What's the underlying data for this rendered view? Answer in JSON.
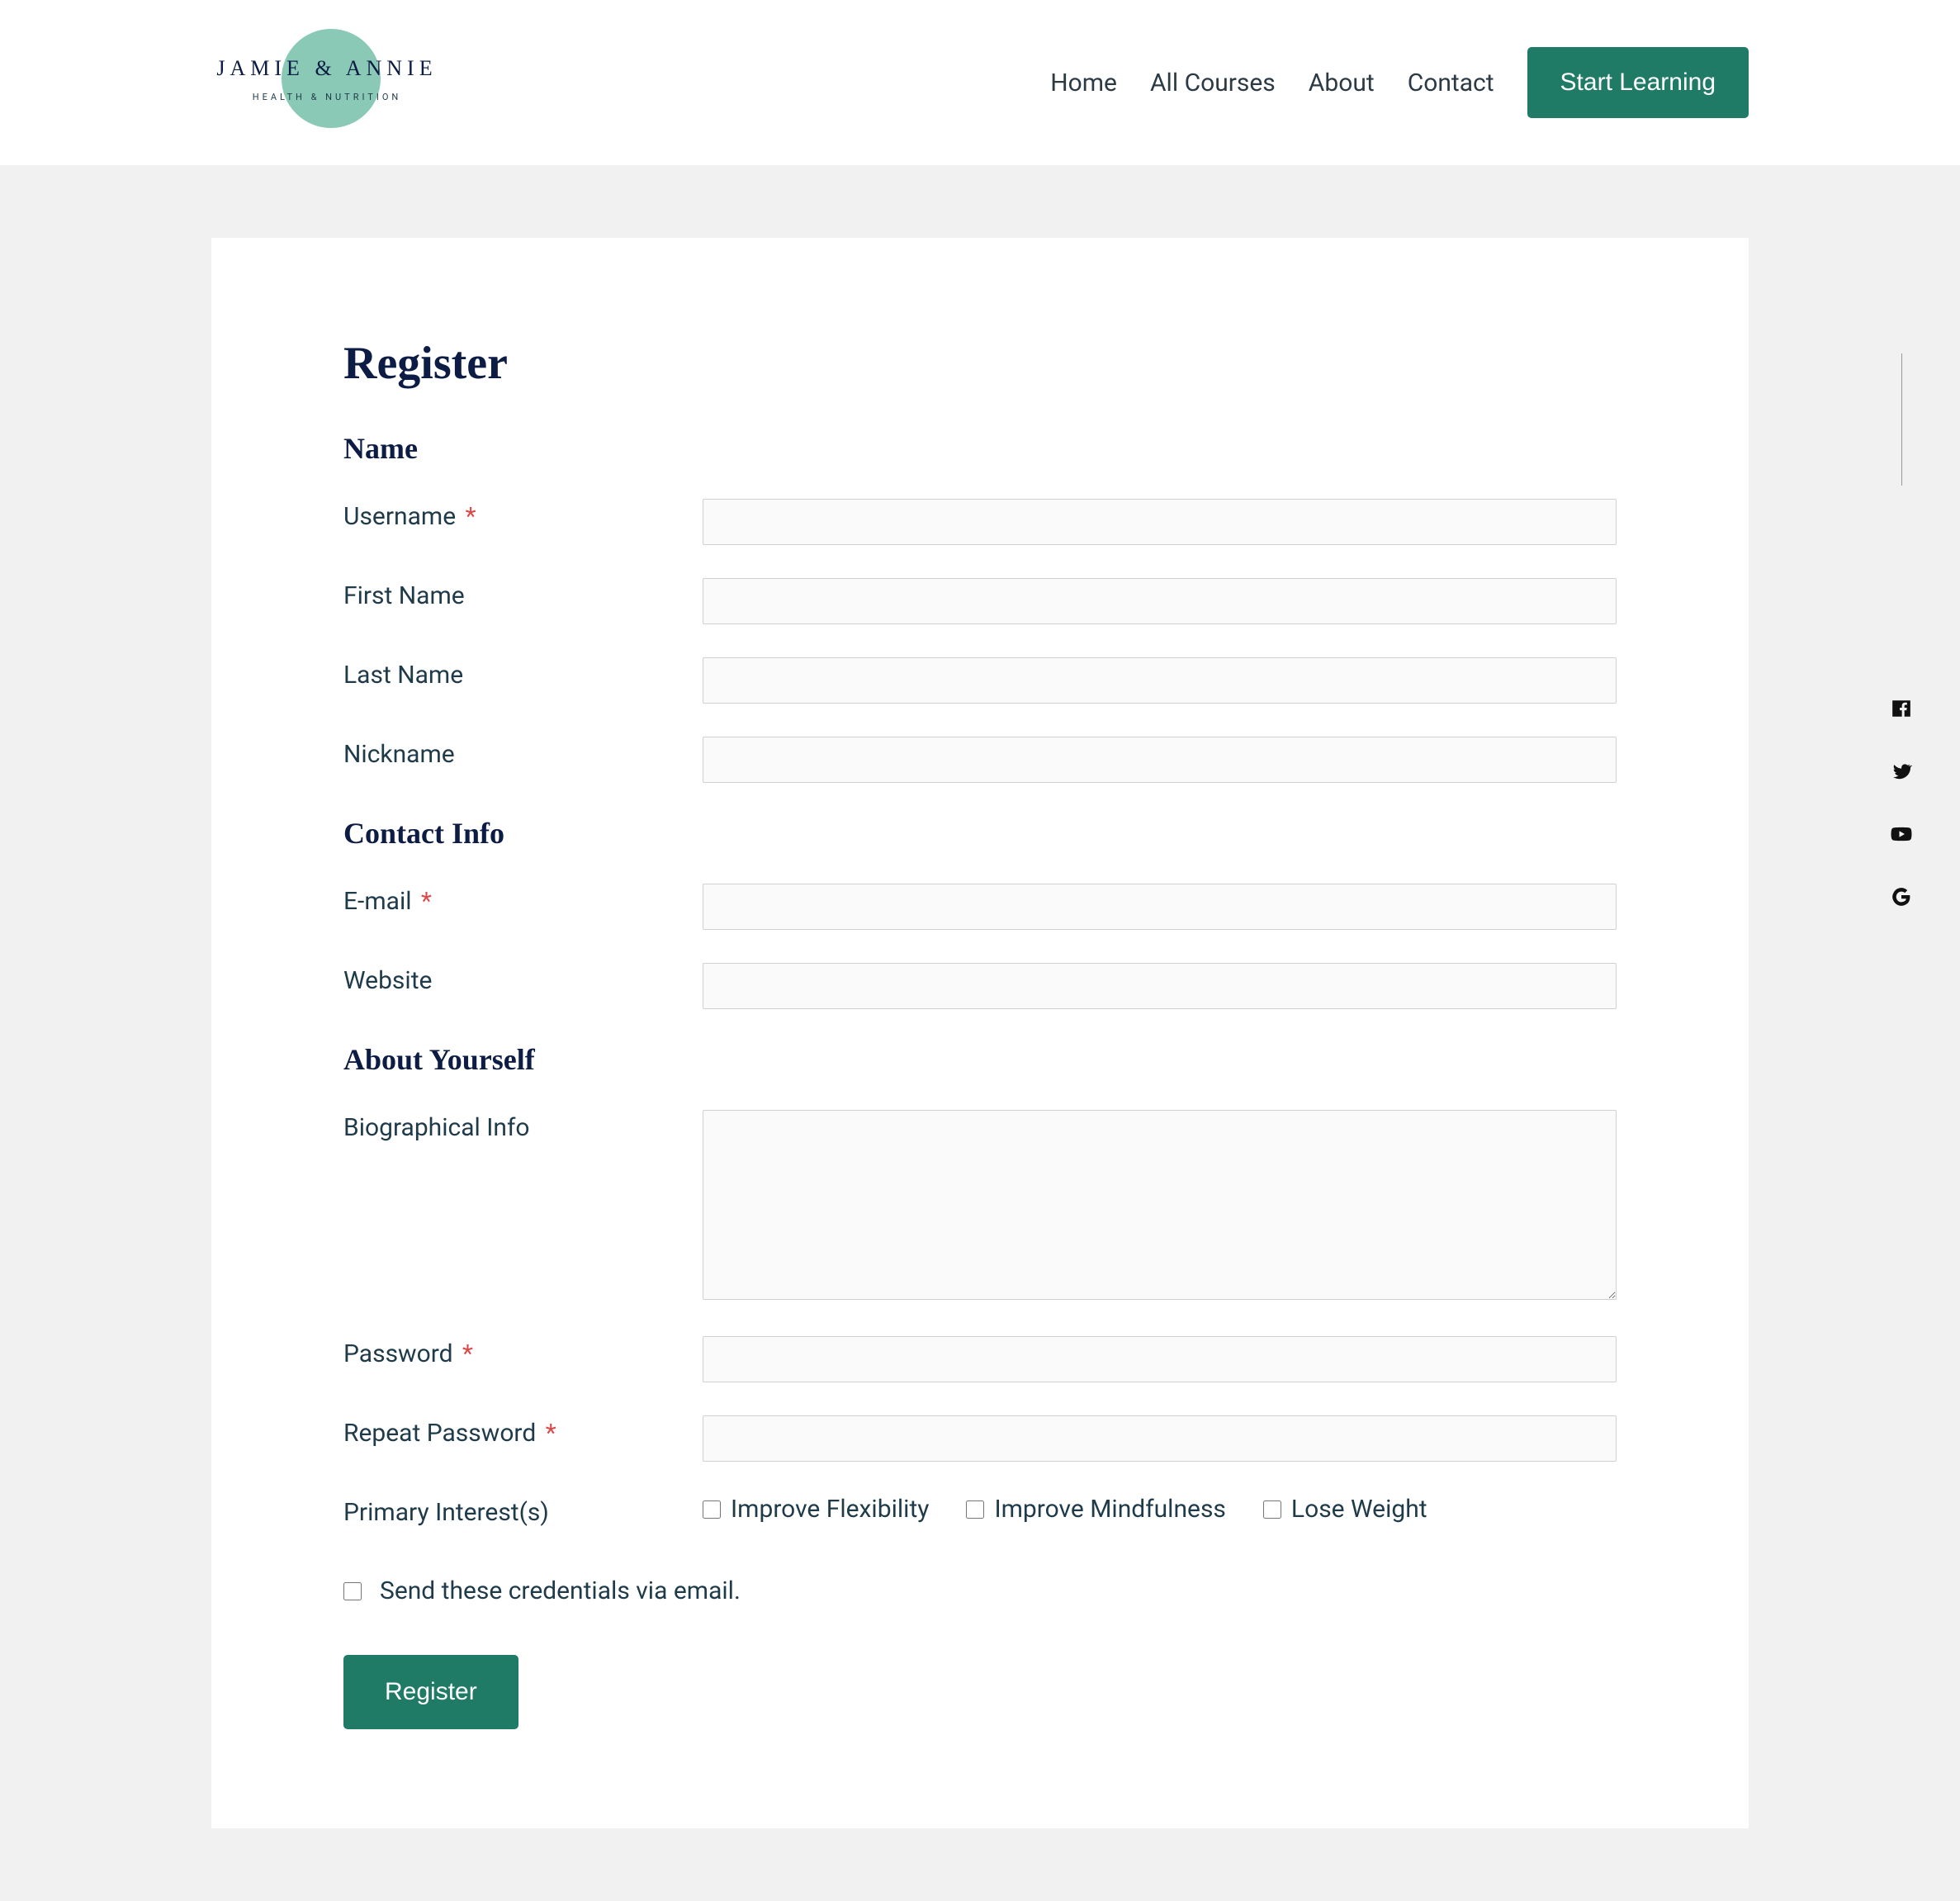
{
  "header": {
    "logo_top": "JAMIE & ANNIE",
    "logo_sub": "HEALTH & NUTRITION",
    "nav": [
      "Home",
      "All Courses",
      "About",
      "Contact"
    ],
    "cta": "Start Learning"
  },
  "page": {
    "title": "Register",
    "sections": {
      "name": {
        "heading": "Name",
        "fields": {
          "username": {
            "label": "Username",
            "required": true
          },
          "first_name": {
            "label": "First Name",
            "required": false
          },
          "last_name": {
            "label": "Last Name",
            "required": false
          },
          "nickname": {
            "label": "Nickname",
            "required": false
          }
        }
      },
      "contact": {
        "heading": "Contact Info",
        "fields": {
          "email": {
            "label": "E-mail",
            "required": true
          },
          "website": {
            "label": "Website",
            "required": false
          }
        }
      },
      "about": {
        "heading": "About Yourself",
        "fields": {
          "bio": {
            "label": "Biographical Info",
            "required": false
          },
          "password": {
            "label": "Password",
            "required": true
          },
          "repeat_password": {
            "label": "Repeat Password",
            "required": true
          },
          "interests": {
            "label": "Primary Interest(s)",
            "options": [
              "Improve Flexibility",
              "Improve Mindfulness",
              "Lose Weight"
            ]
          }
        }
      }
    },
    "send_email": "Send these credentials via email.",
    "submit": "Register"
  },
  "social": [
    "facebook",
    "twitter",
    "youtube",
    "google"
  ],
  "colors": {
    "accent": "#1f7a66",
    "required": "#d94a4a"
  }
}
